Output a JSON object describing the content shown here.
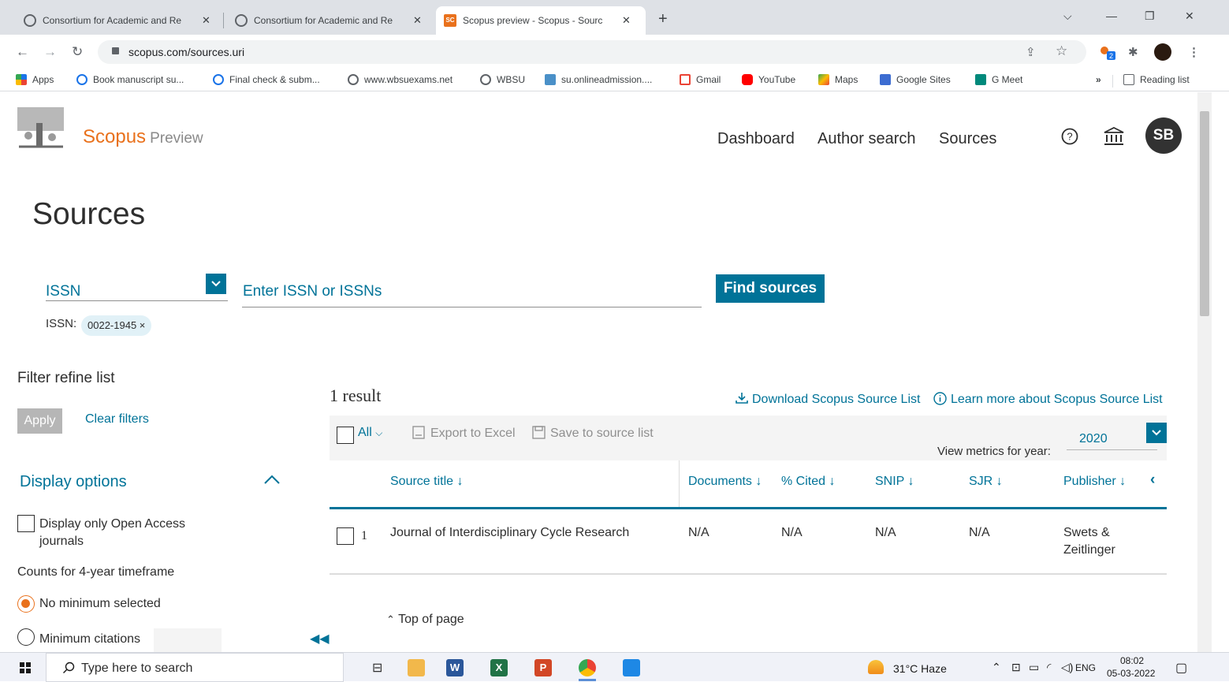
{
  "browser": {
    "tabs": [
      {
        "title": "Consortium for Academic and Re"
      },
      {
        "title": "Consortium for Academic and Re"
      },
      {
        "title": "Scopus preview - Scopus - Sourc"
      }
    ],
    "url": "scopus.com/sources.uri",
    "bookmarks": [
      {
        "label": "Apps",
        "color": "#1a73e8"
      },
      {
        "label": "Book manuscript su...",
        "color": "#1a73e8"
      },
      {
        "label": "Final check & subm...",
        "color": "#1a73e8"
      },
      {
        "label": "www.wbsuexams.net",
        "color": "#5f6368"
      },
      {
        "label": "WBSU",
        "color": "#5f6368"
      },
      {
        "label": "su.onlineadmission....",
        "color": "#4a90c8"
      },
      {
        "label": "Gmail",
        "color": "#ea4335"
      },
      {
        "label": "YouTube",
        "color": "#ff0000"
      },
      {
        "label": "Maps",
        "color": "#34a853"
      },
      {
        "label": "Google Sites",
        "color": "#3c6cd1"
      },
      {
        "label": "G Meet",
        "color": "#00897b"
      }
    ],
    "reading_list": "Reading list",
    "extension_badge": "2"
  },
  "header": {
    "brand": "Scopus",
    "brand_suffix": "Preview",
    "nav": [
      "Dashboard",
      "Author search",
      "Sources"
    ],
    "avatar_initials": "SB"
  },
  "search": {
    "page_title": "Sources",
    "field_type": "ISSN",
    "input_placeholder": "Enter ISSN or ISSNs",
    "find_button": "Find sources",
    "chip_label": "ISSN:",
    "chip_value": "0022-1945",
    "chip_close": "×"
  },
  "filters": {
    "heading": "Filter refine list",
    "apply": "Apply",
    "clear": "Clear filters",
    "display_heading": "Display options",
    "open_access": "Display only Open Access journals",
    "timeframe": "Counts for 4-year timeframe",
    "radio_no_min": "No minimum selected",
    "radio_min_cit": "Minimum citations"
  },
  "results": {
    "count": "1 result",
    "download": "Download Scopus Source List",
    "learn_more": "Learn more about Scopus Source List",
    "all": "All",
    "export": "Export to Excel",
    "save": "Save to source list",
    "metrics_label": "View metrics for year:",
    "year": "2020",
    "columns": [
      "Source title",
      "Documents",
      "% Cited",
      "SNIP",
      "SJR",
      "Publisher"
    ],
    "rows": [
      {
        "index": "1",
        "title": "Journal of Interdisciplinary Cycle Research",
        "documents": "N/A",
        "cited": "N/A",
        "snip": "N/A",
        "sjr": "N/A",
        "publisher": "Swets & Zeitlinger"
      }
    ],
    "top_of_page": "Top of page"
  },
  "taskbar": {
    "search_placeholder": "Type here to search",
    "weather": "31°C  Haze",
    "language": "ENG",
    "time": "08:02",
    "date": "05-03-2022"
  }
}
